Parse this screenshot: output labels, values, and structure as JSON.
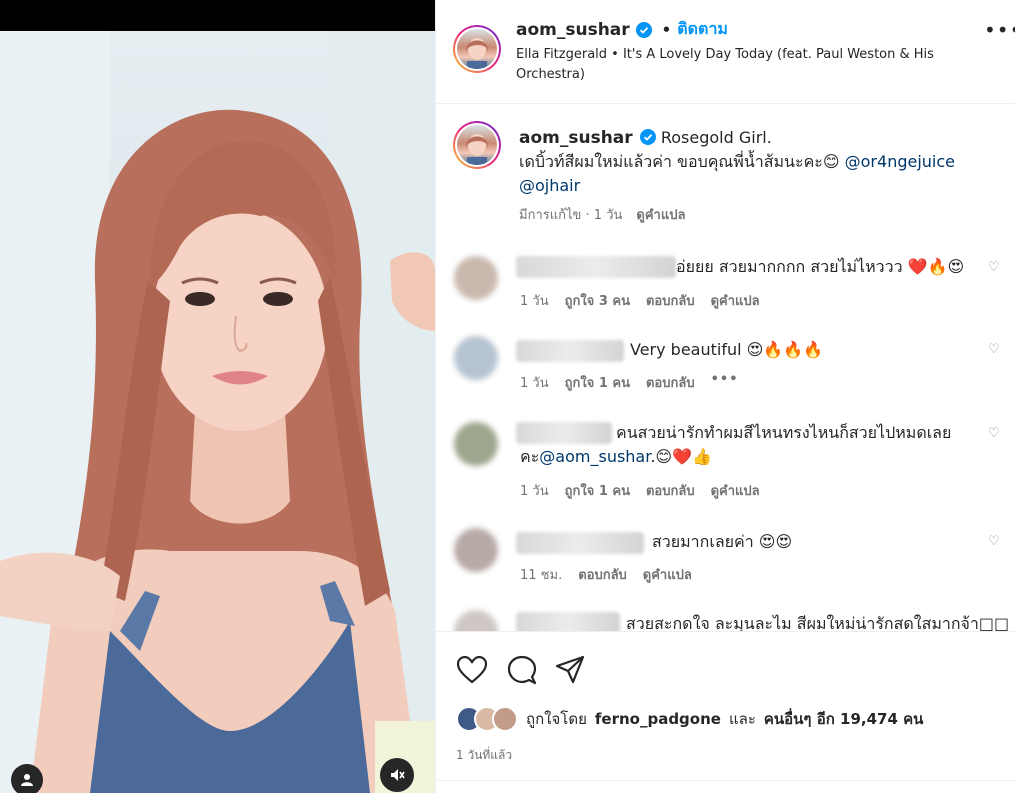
{
  "header": {
    "username": "aom_sushar",
    "separator": "•",
    "follow_label": "ติดตาม",
    "audio": "Ella Fitzgerald • It's A Lovely Day Today (feat. Paul Weston & His Orchestra)",
    "more": "•••"
  },
  "caption": {
    "username": "aom_sushar",
    "text_1": " Rosegold Girl.",
    "text_2": "เดบิ้วท์สีผมใหม่แล้วค่า ขอบคุณพี่น้ำส้มนะคะ😊 ",
    "mention_1": "@or4ngejuice",
    "mention_2": "@ojhair",
    "edited": "มีการแก้ไข · 1 วัน",
    "see_translation": "ดูคำแปล"
  },
  "comments": [
    {
      "text": "อ่ยยย สวยมากกกก สวยไม่ไหววว ❤️🔥😍",
      "time": "1 วัน",
      "likes": "ถูกใจ 3 คน",
      "reply": "ตอบกลับ",
      "translate": "ดูคำแปล",
      "avatar_color": "#c9b8ae"
    },
    {
      "text": "Very beautiful 😍🔥🔥🔥",
      "time": "1 วัน",
      "likes": "ถูกใจ 1 คน",
      "reply": "ตอบกลับ",
      "more": "•••",
      "avatar_color": "#b6c3d1"
    },
    {
      "text": "คนสวยน่ารักทำผมสีไหนทรงไหนก็สวยไปหมดเลย",
      "text_line2_prefix": "คะ",
      "mention": "@aom_sushar",
      "text_line2_suffix": ".😊❤️👍",
      "time": "1 วัน",
      "likes": "ถูกใจ 1 คน",
      "reply": "ตอบกลับ",
      "translate": "ดูคำแปล",
      "avatar_color": "#9ea68e"
    },
    {
      "text": "สวยมากเลยค่า 😍😍",
      "time": "11 ชม.",
      "reply": "ตอบกลับ",
      "translate": "ดูคำแปล",
      "avatar_color": "#b7aaa6"
    },
    {
      "text": "สวยสะกดใจ ละมุนละไม สีผมใหม่น่ารักสดใสมากจ้า□□",
      "avatar_color": "#cfc7c4"
    }
  ],
  "actions": {
    "liked_by_prefix": "ถูกใจโดย",
    "liked_by_user": "ferno_padgone",
    "and_others_prefix": "และ",
    "and_others": "คนอื่นๆ อีก 19,474 คน",
    "time_ago": "1 วันที่แล้ว"
  },
  "icons": {
    "like": "heart-icon",
    "comment": "comment-icon",
    "share": "share-icon",
    "mute": "muted-speaker-icon",
    "tags": "user-tag-icon",
    "verified": "verified-badge-icon"
  },
  "colors": {
    "accent": "#0095f6",
    "mention": "#00376b",
    "verified": "#0095f6"
  }
}
